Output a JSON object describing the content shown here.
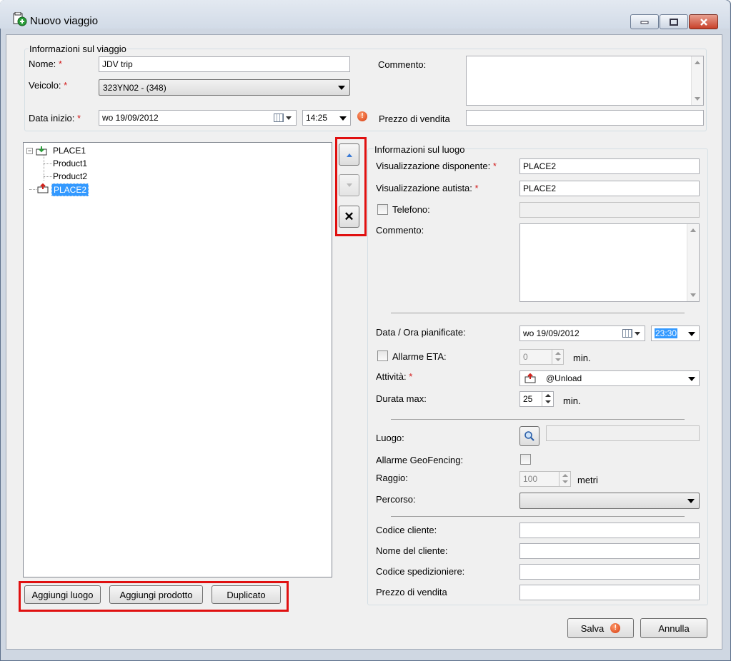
{
  "window": {
    "title": "Nuovo viaggio",
    "accent": "#cfd7e2"
  },
  "trip_info": {
    "group_label": "Informazioni sul viaggio",
    "name_label": "Nome:",
    "name_value": "JDV trip",
    "vehicle_label": "Veicolo:",
    "vehicle_value": "323YN02 - (348)",
    "start_label": "Data inizio:",
    "start_date": "wo 19/09/2012",
    "start_time": "14:25",
    "comment_label": "Commento:",
    "price_label": "Prezzo di vendita",
    "required_mark": "*",
    "warning_icon": "!"
  },
  "tree": {
    "items": [
      {
        "label": "PLACE1"
      },
      {
        "label": "Product1"
      },
      {
        "label": "Product2"
      },
      {
        "label": "PLACE2"
      }
    ]
  },
  "side_buttons": {
    "delete_glyph": "✕"
  },
  "bottom_buttons": {
    "add_place": "Aggiungi luogo",
    "add_product": "Aggiungi prodotto",
    "duplicate": "Duplicato"
  },
  "place_info": {
    "group_label": "Informazioni sul luogo",
    "dispatcher_label": "Visualizzazione disponente:",
    "dispatcher_value": "PLACE2",
    "driver_label": "Visualizzazione autista:",
    "driver_value": "PLACE2",
    "phone_label": "Telefono:",
    "comment_label": "Commento:",
    "planned_label": "Data / Ora pianificate:",
    "planned_date": "wo 19/09/2012",
    "planned_time": "23:30",
    "eta_label": "Allarme ETA:",
    "eta_value": "0",
    "eta_unit": "min.",
    "activity_label": "Attività:",
    "activity_value": "@Unload",
    "duration_label": "Durata max:",
    "duration_value": "25",
    "duration_unit": "min.",
    "place_label": "Luogo:",
    "geofence_label": "Allarme GeoFencing:",
    "radius_label": "Raggio:",
    "radius_value": "100",
    "radius_unit": "metri",
    "route_label": "Percorso:",
    "client_code_label": "Codice cliente:",
    "client_name_label": "Nome del cliente:",
    "forwarder_label": "Codice spedizioniere:",
    "price_label": "Prezzo di vendita"
  },
  "footer": {
    "save": "Salva",
    "cancel": "Annulla"
  }
}
